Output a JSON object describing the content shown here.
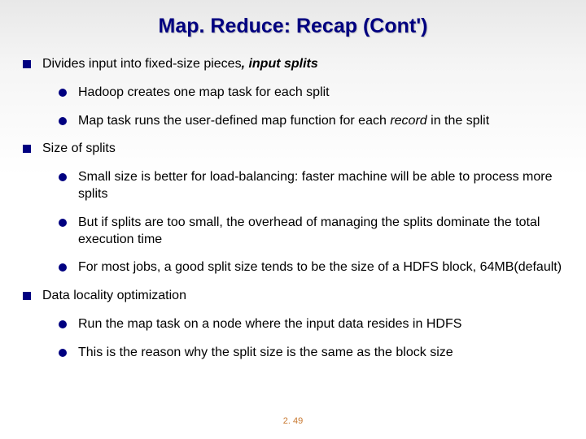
{
  "title": "Map. Reduce: Recap (Cont')",
  "b1": {
    "pre": "Divides input into fixed-size pieces",
    "comma": ", ",
    "em": "input splits",
    "s1": "Hadoop creates one map task for each split",
    "s2a": "Map task runs the user-defined map function for each ",
    "s2em": "record",
    "s2b": " in the split"
  },
  "b2": {
    "t": "Size of splits",
    "s1": "Small size is better for load-balancing: faster machine will be able to process more splits",
    "s2": "But if splits are too small, the overhead of managing the splits dominate the total execution time",
    "s3": "For most jobs, a good split size tends to be the size of a HDFS block, 64MB(default)"
  },
  "b3": {
    "t": "Data locality optimization",
    "s1": "Run the map task on a node where the input data resides in HDFS",
    "s2": "This is the reason why the split size is the same as the block size"
  },
  "page": "2. 49"
}
